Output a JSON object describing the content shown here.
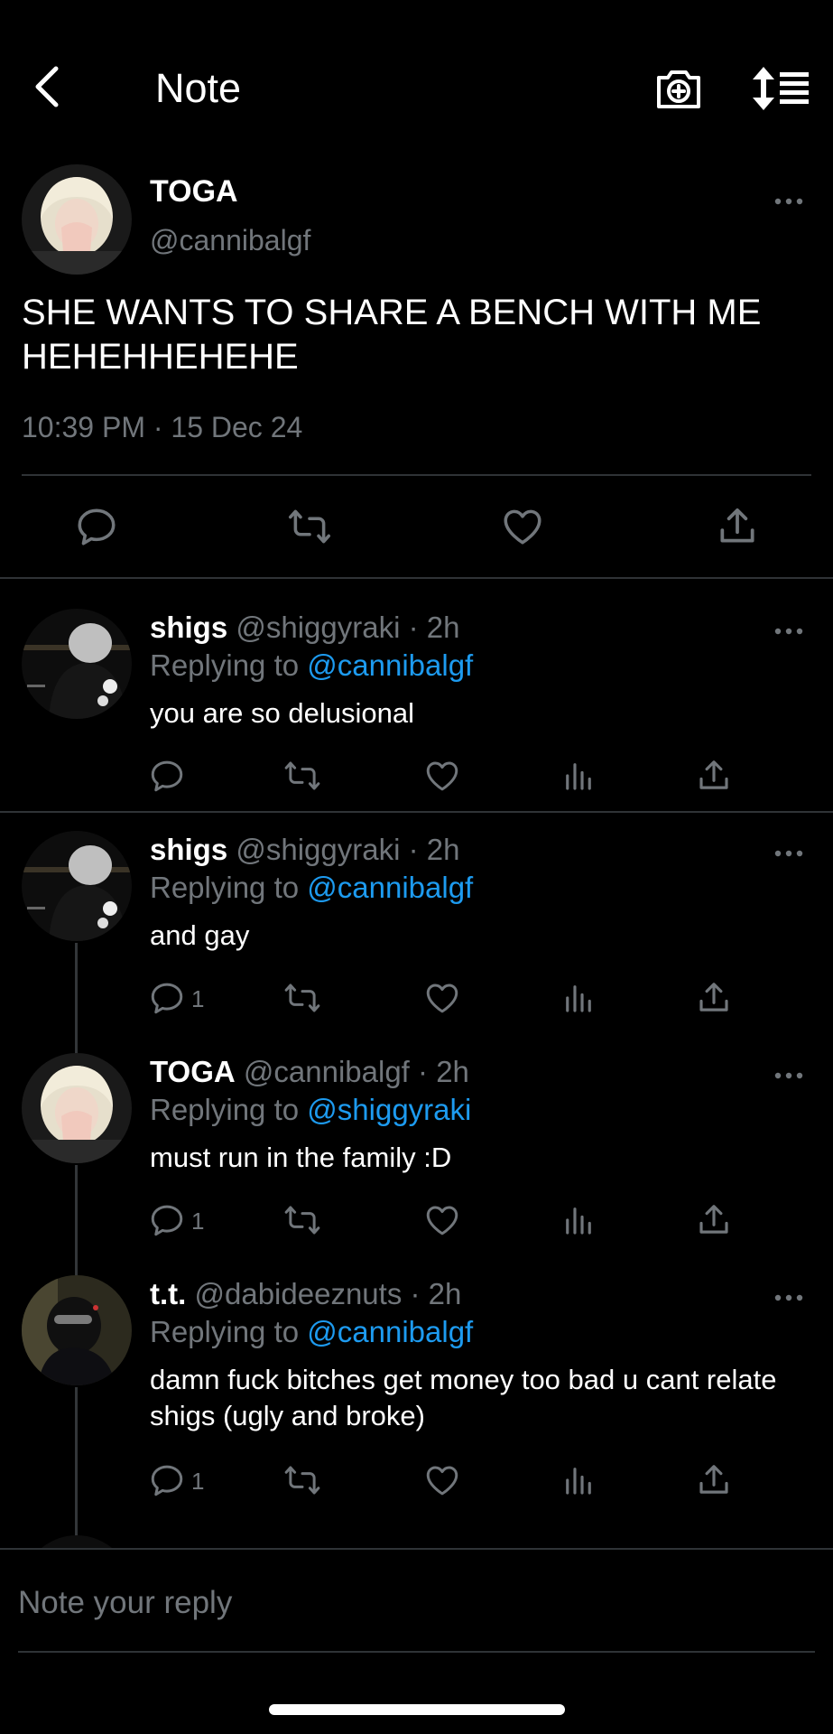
{
  "header": {
    "title": "Note"
  },
  "main": {
    "name": "TOGA",
    "handle": "@cannibalgf",
    "text": "SHE WANTS TO SHARE A BENCH WITH ME HEHEHHEHEHE",
    "timestamp": "10:39 PM · 15 Dec 24"
  },
  "replies": [
    {
      "name": "shigs",
      "handle": "@shiggyraki",
      "time": "2h",
      "replying_prefix": "Replying to",
      "replying_to": "@cannibalgf",
      "text": "you are so delusional",
      "reply_count": ""
    },
    {
      "name": "shigs",
      "handle": "@shiggyraki",
      "time": "2h",
      "replying_prefix": "Replying to",
      "replying_to": "@cannibalgf",
      "text": "and gay",
      "reply_count": "1"
    },
    {
      "name": "TOGA",
      "handle": "@cannibalgf",
      "time": "2h",
      "replying_prefix": "Replying to",
      "replying_to": "@shiggyraki",
      "text": "must run in the family :D",
      "reply_count": "1"
    },
    {
      "name": "t.t.",
      "handle": "@dabideeznuts",
      "time": "2h",
      "replying_prefix": "Replying to",
      "replying_to": "@cannibalgf",
      "text": "damn fuck bitches get money too bad u cant relate shigs (ugly and broke)",
      "reply_count": "1"
    }
  ],
  "compose": {
    "placeholder": "Note your reply"
  },
  "colors": {
    "background": "#000000",
    "accent": "#1d9bf0",
    "muted": "#71767b",
    "divider": "#2f3336"
  },
  "icons": [
    "back-chevron-icon",
    "camera-add-icon",
    "sort-icon",
    "more-icon",
    "reply-icon",
    "repost-icon",
    "like-icon",
    "views-icon",
    "share-icon"
  ]
}
